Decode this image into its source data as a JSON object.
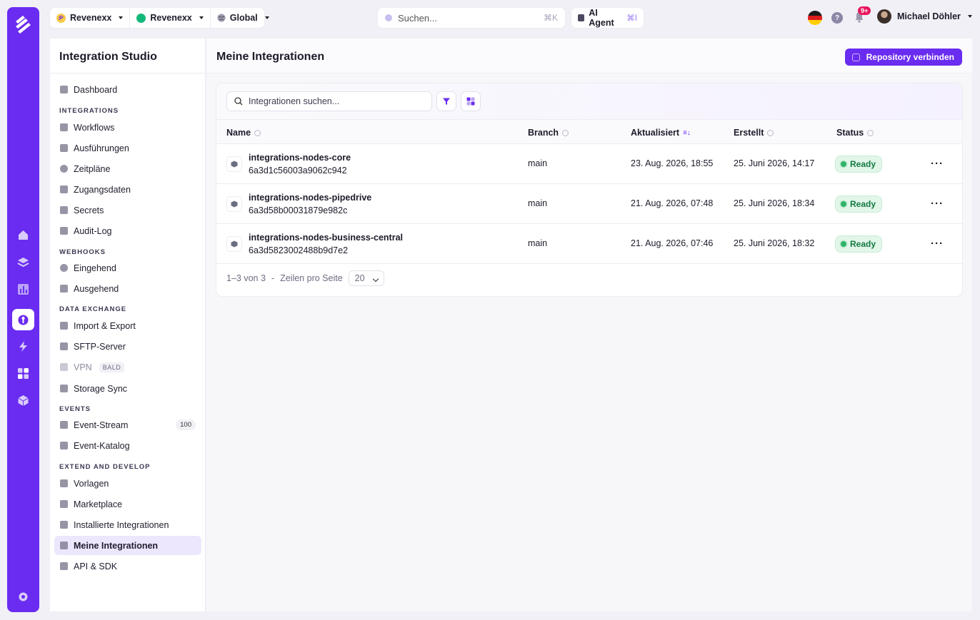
{
  "topbar": {
    "org": "Revenexx",
    "workspace": "Revenexx",
    "scope": "Global",
    "search_placeholder": "Suchen...",
    "search_shortcut": "⌘K",
    "ai_agent_label": "AI Agent",
    "ai_agent_shortcut": "⌘I",
    "help_label": "?",
    "notifications_badge": "9+",
    "user_name": "Michael Döhler"
  },
  "sidebar": {
    "title": "Integration Studio",
    "dashboard": "Dashboard",
    "sections": {
      "integrations": "INTEGRATIONS",
      "webhooks": "WEBHOOKS",
      "data_exchange": "DATA EXCHANGE",
      "events": "EVENTS",
      "extend": "EXTEND AND DEVELOP"
    },
    "items": {
      "workflows": "Workflows",
      "ausfuehrungen": "Ausführungen",
      "zeitplaene": "Zeitpläne",
      "zugangsdaten": "Zugangsdaten",
      "secrets": "Secrets",
      "audit_log": "Audit-Log",
      "eingehend": "Eingehend",
      "ausgehend": "Ausgehend",
      "import_export": "Import & Export",
      "sftp": "SFTP-Server",
      "vpn": "VPN",
      "vpn_badge": "BALD",
      "storage_sync": "Storage Sync",
      "event_stream": "Event-Stream",
      "event_stream_count": "100",
      "event_katalog": "Event-Katalog",
      "vorlagen": "Vorlagen",
      "marketplace": "Marketplace",
      "installierte": "Installierte Integrationen",
      "meine": "Meine Integrationen",
      "api_sdk": "API & SDK"
    }
  },
  "main": {
    "title": "Meine Integrationen",
    "connect_button": "Repository verbinden",
    "search_placeholder": "Integrationen suchen...",
    "columns": {
      "name": "Name",
      "branch": "Branch",
      "updated": "Aktualisiert",
      "created": "Erstellt",
      "status": "Status"
    },
    "rows": [
      {
        "name": "integrations-nodes-core",
        "hash": "6a3d1c56003a9062c942",
        "branch": "main",
        "updated": "23. Aug. 2026, 18:55",
        "created": "25. Juni 2026, 14:17",
        "status": "Ready"
      },
      {
        "name": "integrations-nodes-pipedrive",
        "hash": "6a3d58b00031879e982c",
        "branch": "main",
        "updated": "21. Aug. 2026, 07:48",
        "created": "25. Juni 2026, 18:34",
        "status": "Ready"
      },
      {
        "name": "integrations-nodes-business-central",
        "hash": "6a3d5823002488b9d7e2",
        "branch": "main",
        "updated": "21. Aug. 2026, 07:46",
        "created": "25. Juni 2026, 18:32",
        "status": "Ready"
      }
    ],
    "more_label": "···",
    "pager": {
      "range": "1–3 von 3",
      "separator": "-",
      "rows_per_page_label": "Zeilen pro Seite",
      "rows_per_page_value": "20"
    }
  },
  "colors": {
    "brand": "#6a2cf0",
    "status_green": "#2fb567"
  }
}
